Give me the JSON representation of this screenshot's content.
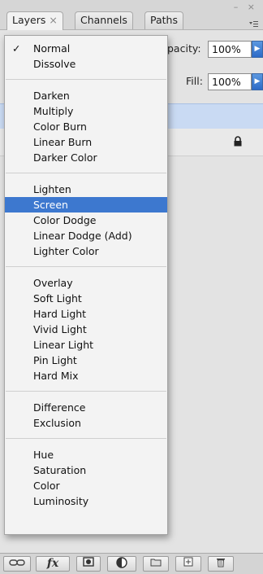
{
  "tabs": [
    {
      "label": "Layers",
      "close": "×"
    },
    {
      "label": "Channels"
    },
    {
      "label": "Paths"
    }
  ],
  "window_controls": "– ×",
  "panel_menu_icon": "menu-icon",
  "opacity": {
    "label": "pacity:",
    "value": "100%"
  },
  "fill": {
    "label": "Fill:",
    "value": "100%"
  },
  "blend_menu": {
    "checked": "Normal",
    "selected": "Screen",
    "check_mark": "✓",
    "groups": [
      [
        "Normal",
        "Dissolve"
      ],
      [
        "Darken",
        "Multiply",
        "Color Burn",
        "Linear Burn",
        "Darker Color"
      ],
      [
        "Lighten",
        "Screen",
        "Color Dodge",
        "Linear Dodge (Add)",
        "Lighter Color"
      ],
      [
        "Overlay",
        "Soft Light",
        "Hard Light",
        "Vivid Light",
        "Linear Light",
        "Pin Light",
        "Hard Mix"
      ],
      [
        "Difference",
        "Exclusion"
      ],
      [
        "Hue",
        "Saturation",
        "Color",
        "Luminosity"
      ]
    ]
  },
  "toolbar": {
    "link_icon": "link-icon",
    "fx_label": "fx",
    "mask_icon": "layer-mask-icon",
    "adjust_icon": "adjustment-layer-icon",
    "group_icon": "folder-icon",
    "new_layer_icon": "new-layer-icon",
    "trash_icon": "trash-icon"
  },
  "colors": {
    "selection": "#3d78cf",
    "layer_highlight": "#c9daf3"
  }
}
